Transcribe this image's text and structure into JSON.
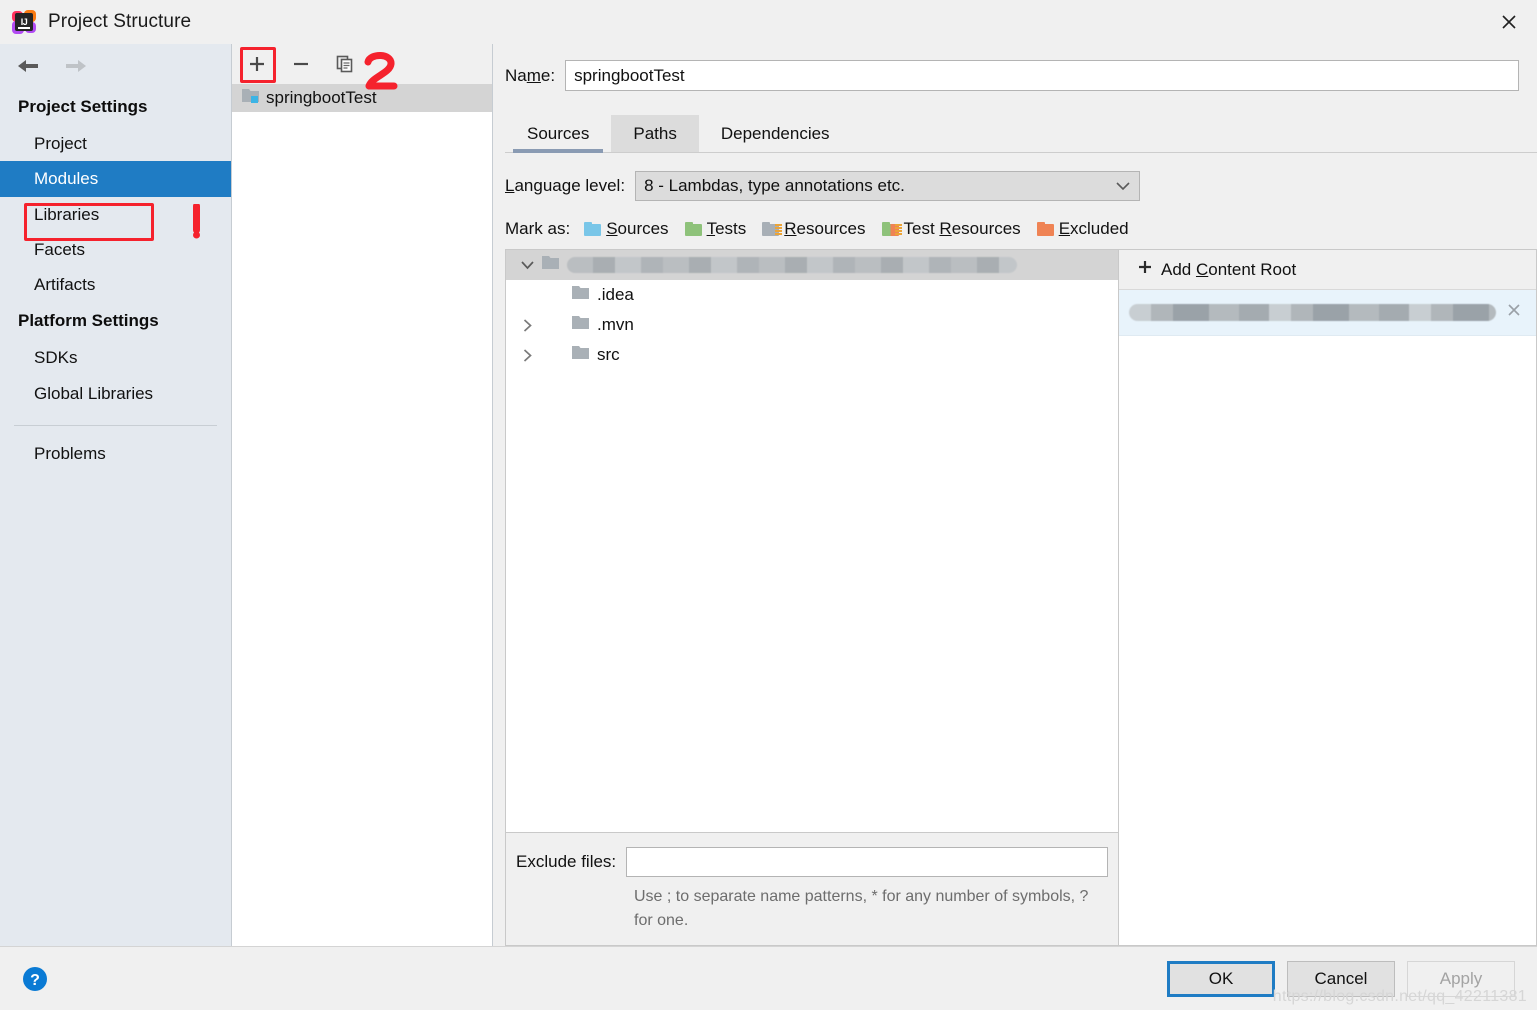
{
  "window": {
    "title": "Project Structure",
    "logo_text": "IJ",
    "close_icon": "close-icon"
  },
  "sidebar": {
    "back_icon": "arrow-left-icon",
    "forward_icon": "arrow-right-icon",
    "groups": [
      {
        "title": "Project Settings",
        "items": [
          {
            "label": "Project",
            "selected": false
          },
          {
            "label": "Modules",
            "selected": true
          },
          {
            "label": "Libraries",
            "selected": false
          },
          {
            "label": "Facets",
            "selected": false
          },
          {
            "label": "Artifacts",
            "selected": false
          }
        ]
      },
      {
        "title": "Platform Settings",
        "items": [
          {
            "label": "SDKs",
            "selected": false
          },
          {
            "label": "Global Libraries",
            "selected": false
          }
        ]
      }
    ],
    "problems_label": "Problems",
    "selection_color": "#1f7cc4"
  },
  "modules_panel": {
    "toolbar": {
      "add_label": "+",
      "remove_label": "−",
      "copy_icon": "copy-icon"
    },
    "items": [
      {
        "label": "springbootTest",
        "selected": true
      }
    ]
  },
  "annotations": {
    "color": "#f5222d",
    "marker_one": "1",
    "marker_two": "2"
  },
  "main": {
    "name_label_pre": "Na",
    "name_label_mnemonic": "m",
    "name_label_post": "e:",
    "name_value": "springbootTest",
    "name_placeholder": "",
    "tabs": [
      {
        "label": "Sources",
        "state": "selected"
      },
      {
        "label": "Paths",
        "state": "hover"
      },
      {
        "label": "Dependencies",
        "state": "normal"
      }
    ],
    "language_level": {
      "label_mnemonic": "L",
      "label_rest": "anguage level:",
      "value": "8 - Lambdas, type annotations etc.",
      "chevron_icon": "chevron-down-icon"
    },
    "mark_as": {
      "label": "Mark as:",
      "options": [
        {
          "pre": "",
          "mnemonic": "S",
          "post": "ources",
          "icon": "folder-sources-icon",
          "color": "#79c6e8"
        },
        {
          "pre": "",
          "mnemonic": "T",
          "post": "ests",
          "icon": "folder-tests-icon",
          "color": "#8ec27a"
        },
        {
          "pre": "",
          "mnemonic": "R",
          "post": "esources",
          "icon": "folder-resources-icon",
          "color": "#a8afb6"
        },
        {
          "pre": "Test ",
          "mnemonic": "R",
          "post": "esources",
          "icon": "folder-test-resources-icon",
          "color": "#8ec27a"
        },
        {
          "pre": "",
          "mnemonic": "E",
          "post": "xcluded",
          "icon": "folder-excluded-icon",
          "color": "#ef8354"
        }
      ]
    },
    "tree": {
      "root": {
        "label": "",
        "redacted": true,
        "expanded": true,
        "icon": "folder-icon"
      },
      "children": [
        {
          "label": ".idea",
          "has_chevron": false,
          "icon": "folder-icon"
        },
        {
          "label": ".mvn",
          "has_chevron": true,
          "icon": "folder-icon"
        },
        {
          "label": "src",
          "has_chevron": true,
          "icon": "folder-icon"
        }
      ]
    },
    "exclude": {
      "label": "Exclude files:",
      "value": "",
      "placeholder": "",
      "hint": "Use ; to separate name patterns, * for any number of symbols, ? for one."
    },
    "content_root": {
      "add_pre": "Add ",
      "add_mnemonic": "C",
      "add_post": "ontent Root",
      "add_icon": "plus-icon",
      "entries": [
        {
          "redacted": true,
          "remove_icon": "close-icon"
        }
      ]
    }
  },
  "footer": {
    "help_icon": "help-icon",
    "ok_label": "OK",
    "cancel_label": "Cancel",
    "apply_label": "Apply",
    "apply_disabled": true,
    "watermark": "https://blog.csdn.net/qq_42211381"
  }
}
